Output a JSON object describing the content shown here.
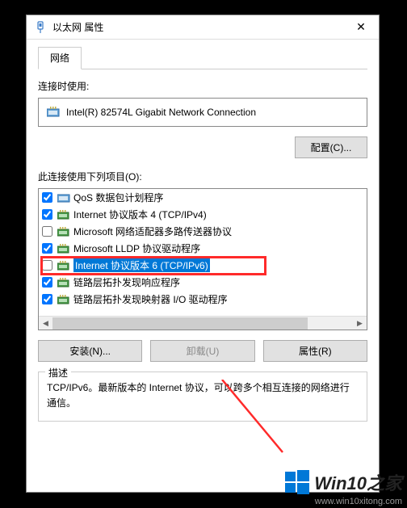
{
  "titlebar": {
    "title": "以太网 属性"
  },
  "tab": {
    "network": "网络"
  },
  "connect_using_label": "连接时使用:",
  "adapter": {
    "name": "Intel(R) 82574L Gigabit Network Connection"
  },
  "configure_btn": "配置(C)...",
  "items_label": "此连接使用下列项目(O):",
  "items": [
    {
      "checked": true,
      "icon": "qos",
      "label": "QoS 数据包计划程序"
    },
    {
      "checked": true,
      "icon": "proto",
      "label": "Internet 协议版本 4 (TCP/IPv4)"
    },
    {
      "checked": false,
      "icon": "proto",
      "label": "Microsoft 网络适配器多路传送器协议"
    },
    {
      "checked": true,
      "icon": "proto",
      "label": "Microsoft LLDP 协议驱动程序"
    },
    {
      "checked": false,
      "icon": "proto",
      "label": "Internet 协议版本 6 (TCP/IPv6)",
      "selected": true
    },
    {
      "checked": true,
      "icon": "proto",
      "label": "链路层拓扑发现响应程序"
    },
    {
      "checked": true,
      "icon": "proto",
      "label": "链路层拓扑发现映射器 I/O 驱动程序"
    }
  ],
  "buttons": {
    "install": "安装(N)...",
    "uninstall": "卸载(U)",
    "properties": "属性(R)"
  },
  "description": {
    "legend": "描述",
    "text": "TCP/IPv6。最新版本的 Internet 协议，可以跨多个相互连接的网络进行通信。"
  },
  "watermark": {
    "title": "Win10之家",
    "url": "www.win10xitong.com"
  }
}
